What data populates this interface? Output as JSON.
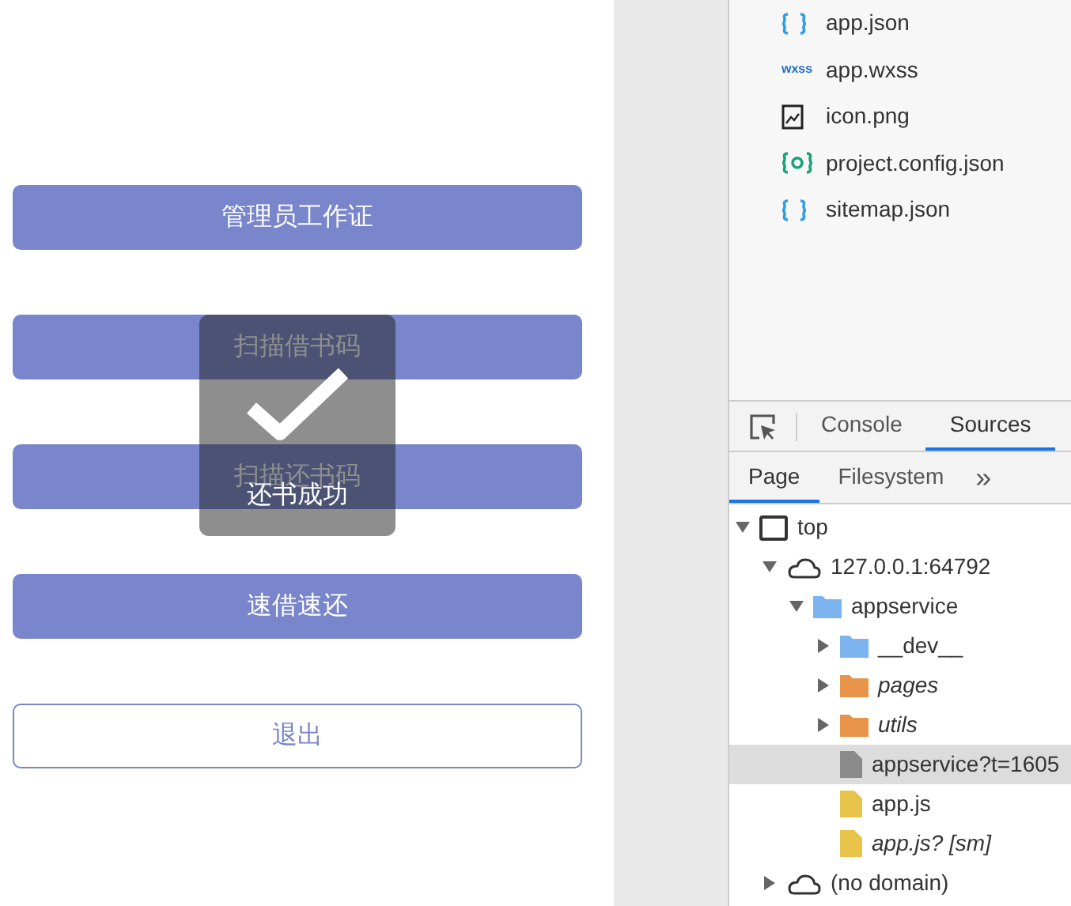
{
  "phone": {
    "buttons": [
      {
        "label": "管理员工作证",
        "kind": "filled"
      },
      {
        "label": "扫描借书码",
        "kind": "filled"
      },
      {
        "label": "扫描还书码",
        "kind": "filled"
      },
      {
        "label": "速借速还",
        "kind": "filled"
      },
      {
        "label": "退出",
        "kind": "outline"
      }
    ],
    "toast": {
      "text": "还书成功"
    }
  },
  "files": [
    {
      "name": "app.json",
      "kind": "json"
    },
    {
      "name": "app.wxss",
      "kind": "wxss",
      "badge": "wxss"
    },
    {
      "name": "icon.png",
      "kind": "image"
    },
    {
      "name": "project.config.json",
      "kind": "config"
    },
    {
      "name": "sitemap.json",
      "kind": "json"
    }
  ],
  "devtools": {
    "tabs": [
      {
        "label": "Console",
        "selected": false
      },
      {
        "label": "Sources",
        "selected": true
      }
    ],
    "subtabs": [
      {
        "label": "Page",
        "selected": true
      },
      {
        "label": "Filesystem",
        "selected": false
      }
    ],
    "more": "»",
    "tree": [
      {
        "label": "top",
        "kind": "frame",
        "expanded": true,
        "children": [
          {
            "label": "127.0.0.1:64792",
            "kind": "cloud",
            "expanded": true,
            "children": [
              {
                "label": "appservice",
                "kind": "folder",
                "color": "#7cb4f0",
                "expanded": true,
                "children": [
                  {
                    "label": "__dev__",
                    "kind": "folder",
                    "color": "#7cb4f0",
                    "expanded": false
                  },
                  {
                    "label": "pages",
                    "kind": "folder",
                    "color": "#e8934a",
                    "expanded": false,
                    "italic": true
                  },
                  {
                    "label": "utils",
                    "kind": "folder",
                    "color": "#e8934a",
                    "expanded": false,
                    "italic": true
                  },
                  {
                    "label": "appservice?t=1605",
                    "kind": "file",
                    "color": "#8a8a8a",
                    "selected": true
                  },
                  {
                    "label": "app.js",
                    "kind": "file",
                    "color": "#e8c34a",
                    "selected": false
                  },
                  {
                    "label": "app.js? [sm]",
                    "kind": "file",
                    "color": "#e8c34a",
                    "selected": false,
                    "italic": true
                  }
                ]
              }
            ]
          },
          {
            "label": "(no domain)",
            "kind": "cloud",
            "expanded": false
          }
        ]
      }
    ]
  }
}
